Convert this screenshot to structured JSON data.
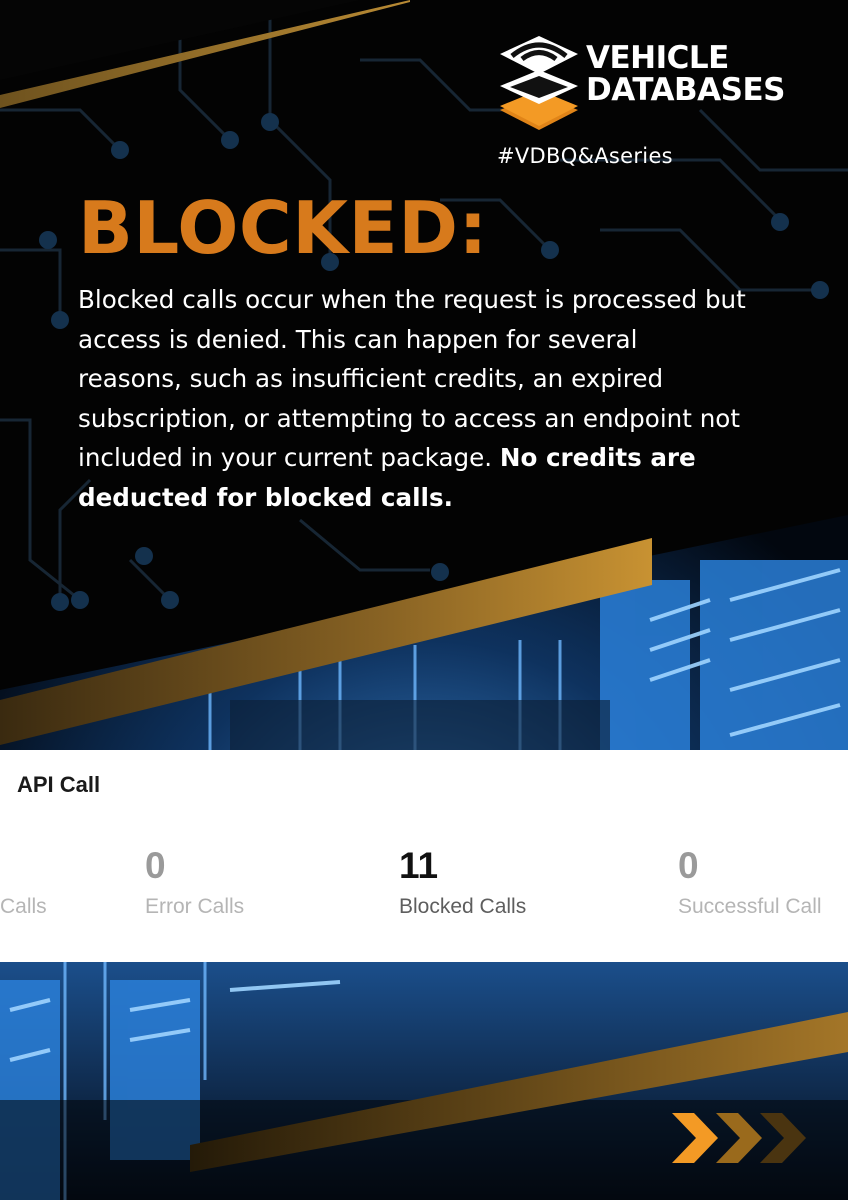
{
  "brand": {
    "line1": "VEHICLE",
    "line2": "DATABASES",
    "hashtag": "#VDBQ&Aseries"
  },
  "section": {
    "heading": "BLOCKED:",
    "body_regular": "Blocked calls occur when the request is processed but access is denied. This can happen for several reasons, such as insufficient credits, an expired subscription, or attempting to access an endpoint not included in your current package.",
    "body_bold": "No credits are deducted for blocked calls."
  },
  "api_panel": {
    "title": "API Call",
    "stats": [
      {
        "value": "",
        "label": "Calls"
      },
      {
        "value": "0",
        "label": "Error Calls"
      },
      {
        "value": "11",
        "label": "Blocked Calls"
      },
      {
        "value": "0",
        "label": "Successful Call"
      }
    ]
  },
  "icons": {
    "logo": "stacked-layers-logo-icon",
    "decor": "chevron-arrows-icon"
  },
  "colors": {
    "accent_orange": "#d77a1c",
    "gold": "#b8862c",
    "background": "#030303",
    "server_blue": "#2a7fd8",
    "panel_white": "#ffffff"
  }
}
